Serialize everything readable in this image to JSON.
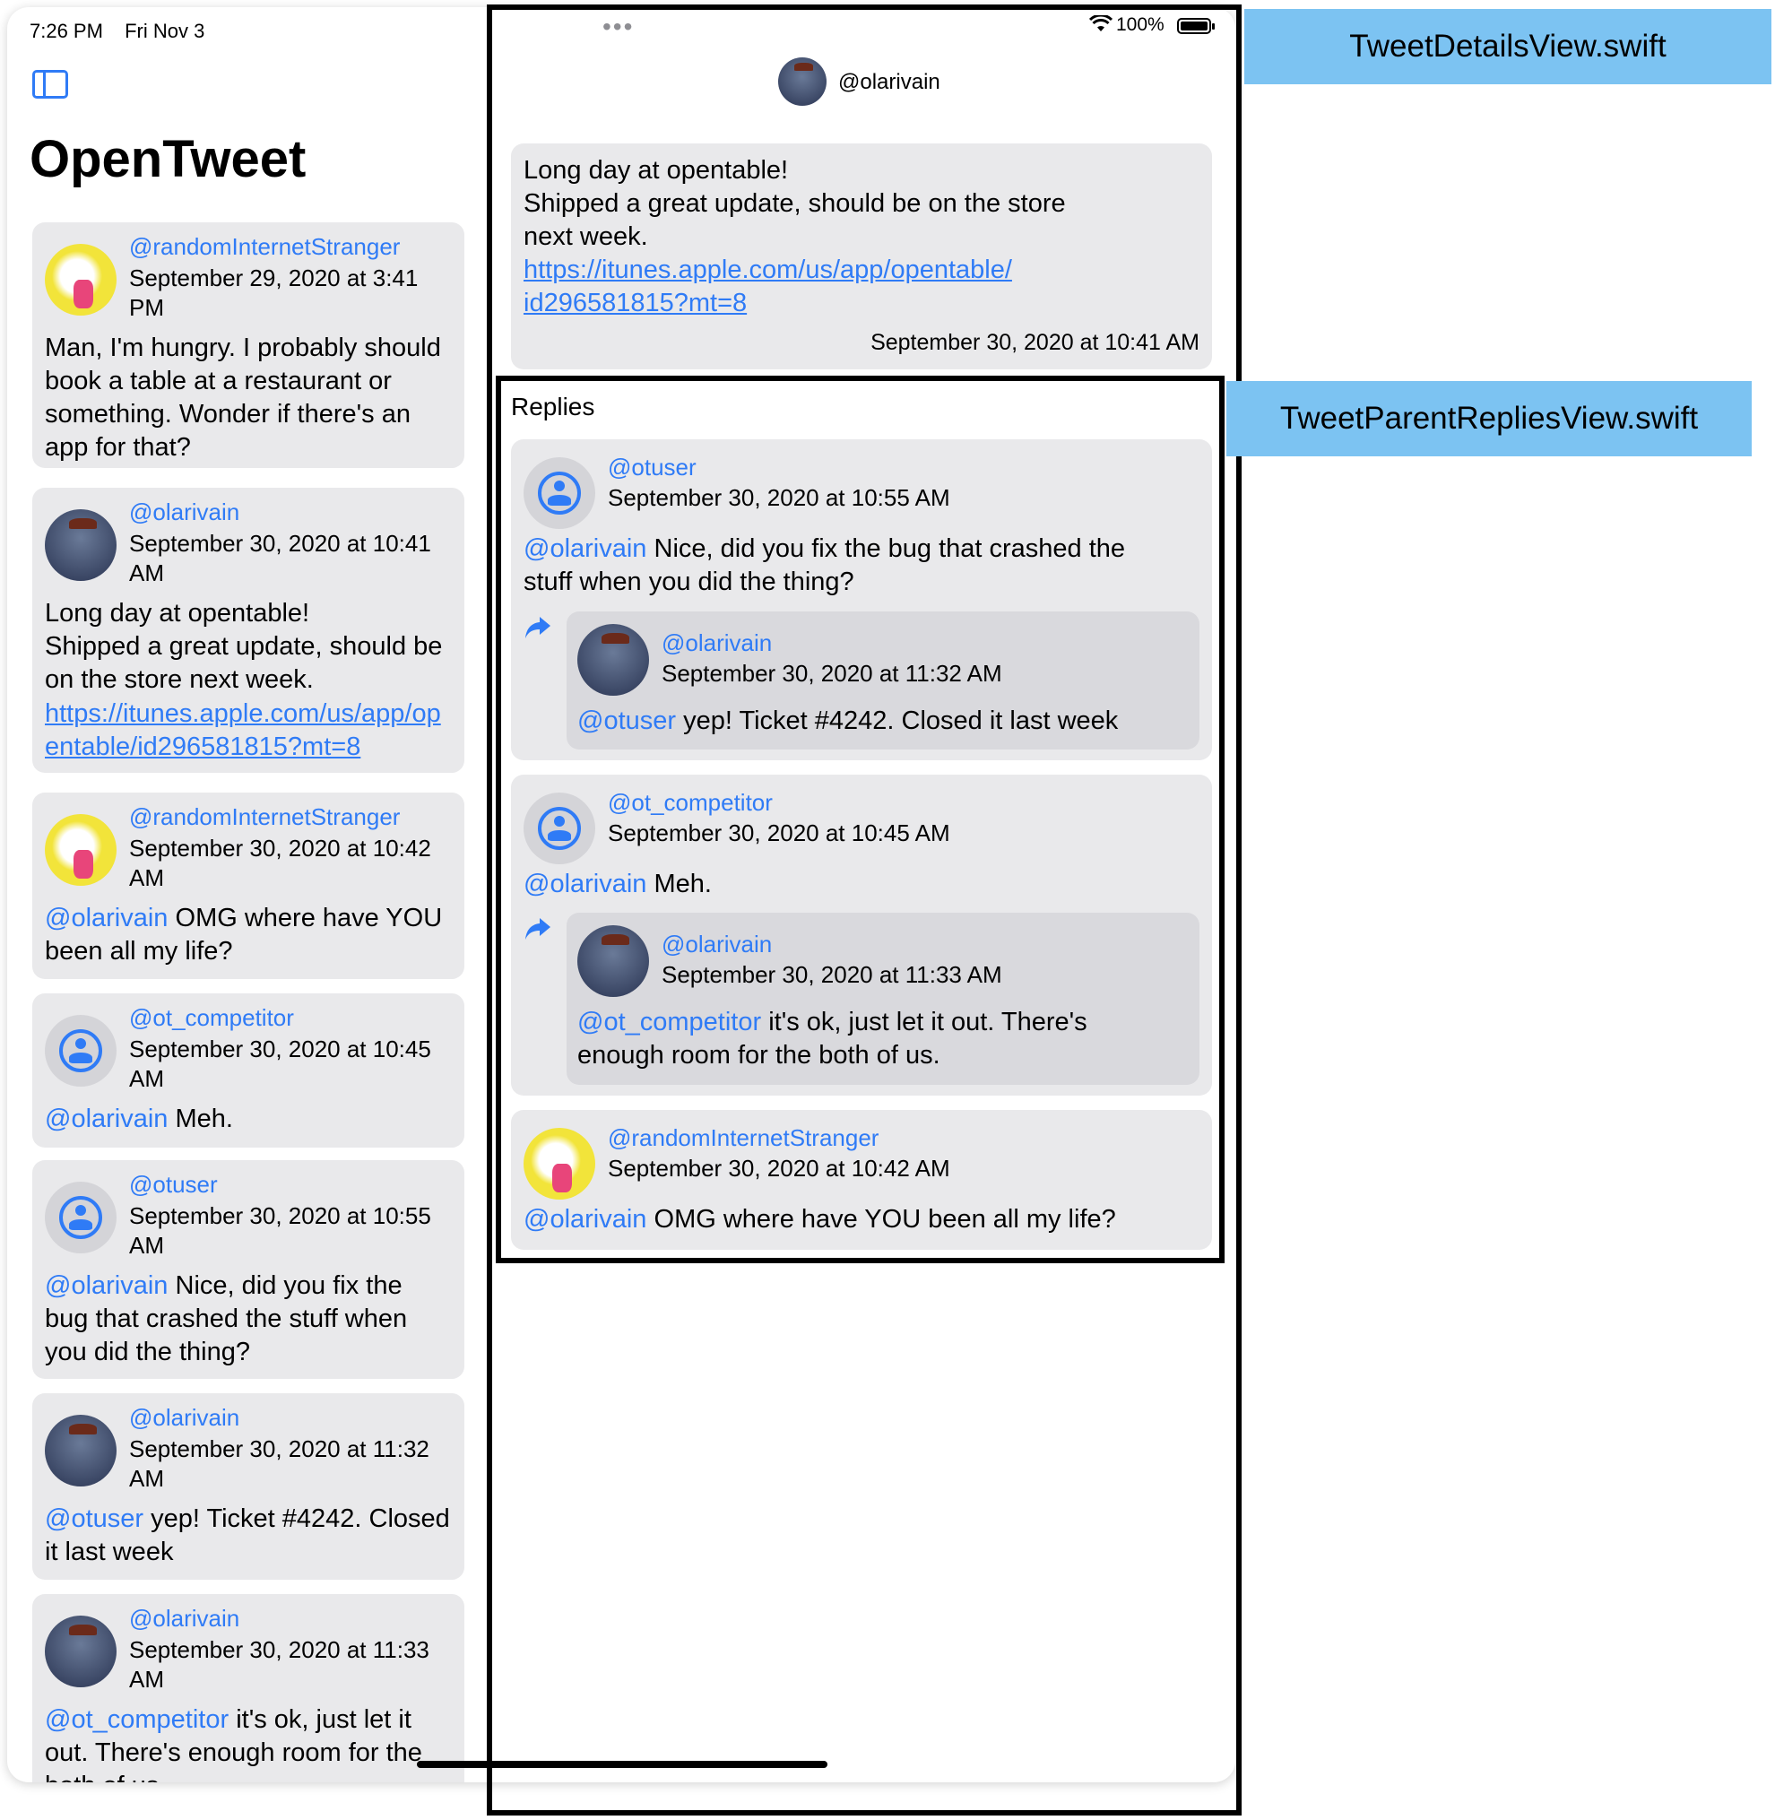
{
  "status": {
    "time": "7:26 PM",
    "date": "Fri Nov 3",
    "battery": "100%"
  },
  "app": {
    "title": "OpenTweet"
  },
  "icons": {
    "sidebar_toggle": "sidebar-toggle-icon",
    "wifi": "wifi-icon",
    "battery": "battery-icon",
    "reply": "reply-arrow-icon",
    "more": "more-dots-icon"
  },
  "colors": {
    "accent": "#2f7bf6",
    "card_bg": "#e9e9eb",
    "nested_bg": "#d9d9dd",
    "label_bg": "#7cc3f2"
  },
  "feed": [
    {
      "handle": "@randomInternetStranger",
      "date": "September 29, 2020 at 3:41 PM",
      "mention": "",
      "text": "Man, I'm hungry. I probably should book a table at a restaurant or something. Wonder if there's an app for that?"
    },
    {
      "handle": "@olarivain",
      "date": "September 30, 2020 at 10:41 AM",
      "mention": "",
      "text": "Long day at opentable!\nShipped a great update, should be on the store next week.",
      "link": "https://itunes.apple.com/us/app/opentable/id296581815?mt=8"
    },
    {
      "handle": "@randomInternetStranger",
      "date": "September 30, 2020 at 10:42 AM",
      "mention": "@olarivain",
      "text": " OMG where have YOU been all my life?"
    },
    {
      "handle": "@ot_competitor",
      "date": "September 30, 2020 at 10:45 AM",
      "mention": "@olarivain",
      "text": " Meh."
    },
    {
      "handle": "@otuser",
      "date": "September 30, 2020 at 10:55 AM",
      "mention": "@olarivain",
      "text": " Nice, did you fix the bug that crashed the stuff when you did the thing?"
    },
    {
      "handle": "@olarivain",
      "date": "September 30, 2020 at 11:32 AM",
      "mention": "@otuser",
      "text": " yep! Ticket #4242. Closed it last week"
    },
    {
      "handle": "@olarivain",
      "date": "September 30, 2020 at 11:33 AM",
      "mention": "@ot_competitor",
      "text": " it's ok, just let it out. There's enough room for the both of us."
    }
  ],
  "detail": {
    "handle": "@olarivain",
    "text": "Long day at opentable!\nShipped a great update, should be on the store\nnext week.",
    "link": "https://itunes.apple.com/us/app/opentable/\nid296581815?mt=8",
    "date": "September 30, 2020 at 10:41 AM",
    "replies_title": "Replies",
    "replies": [
      {
        "handle": "@otuser",
        "date": "September 30, 2020 at 10:55 AM",
        "mention": "@olarivain",
        "text": " Nice, did you fix the bug that crashed the\nstuff when you did the thing?",
        "nested": {
          "handle": "@olarivain",
          "date": "September 30, 2020 at 11:32 AM",
          "mention": "@otuser",
          "text": " yep! Ticket #4242. Closed it last week"
        }
      },
      {
        "handle": "@ot_competitor",
        "date": "September 30, 2020 at 10:45 AM",
        "mention": "@olarivain",
        "text": " Meh.",
        "nested": {
          "handle": "@olarivain",
          "date": "September 30, 2020 at 11:33 AM",
          "mention": "@ot_competitor",
          "text": " it's ok, just let it out. There's\nenough room for the both of us."
        }
      },
      {
        "handle": "@randomInternetStranger",
        "date": "September 30, 2020 at 10:42 AM",
        "mention": "@olarivain",
        "text": " OMG where have YOU been all my life?"
      }
    ]
  },
  "labels": {
    "details_view": "TweetDetailsView.swift",
    "replies_view": "TweetParentRepliesView.swift"
  }
}
